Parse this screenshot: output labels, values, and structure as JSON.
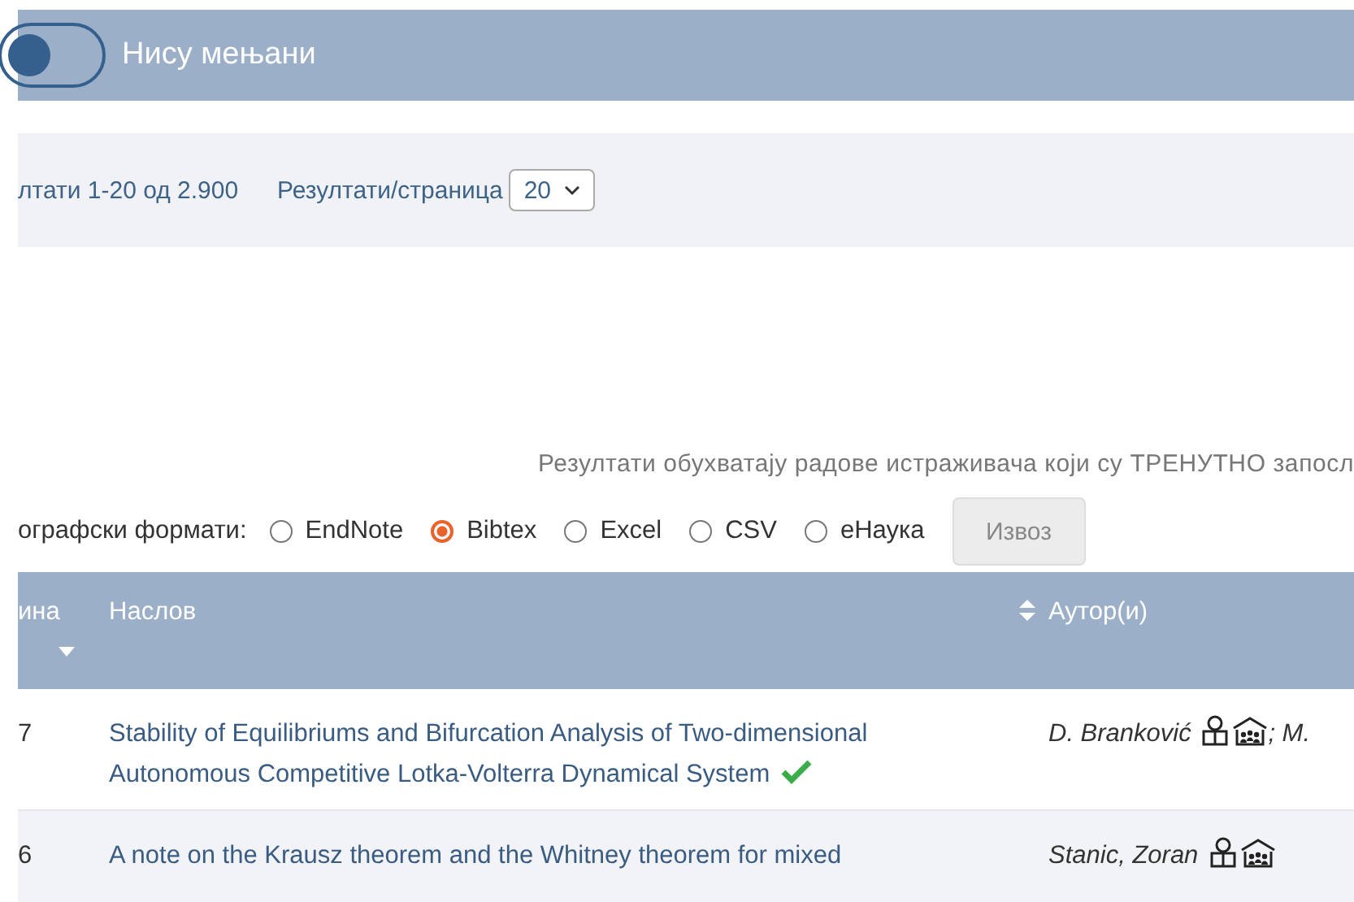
{
  "filter_bar": {
    "toggle": {
      "label": "Нису мењани",
      "on": false
    }
  },
  "results_bar": {
    "range": "лтати 1-20 од 2.900",
    "per_page_label": "Резултати/страница",
    "per_page": "20"
  },
  "note": "Резултати обухватају радове истраживача који су ТРЕНУТНО запосл",
  "export": {
    "label": "ографски формати:",
    "formats": [
      {
        "label": "EndNote",
        "selected": false
      },
      {
        "label": "Bibtex",
        "selected": true
      },
      {
        "label": "Excel",
        "selected": false
      },
      {
        "label": "CSV",
        "selected": false
      },
      {
        "label": "еНаука",
        "selected": false
      }
    ],
    "button": {
      "label": "Извоз",
      "disabled": true
    }
  },
  "table": {
    "columns": [
      {
        "label": "ина",
        "kind": "sorted"
      },
      {
        "label": "Наслов",
        "kind": "sortable"
      },
      {
        "label": "Аутор(и)",
        "kind": "plain"
      }
    ],
    "rows": [
      {
        "year": "7",
        "title": "Stability of Equilibriums and Bifurcation Analysis of Two-dimensional Autonomous Competitive Lotka-Volterra Dynamical System",
        "verified": true,
        "authors": [
          {
            "name": "D. Branković",
            "profile": true
          },
          {
            "name": "; M.",
            "profile": false
          }
        ]
      },
      {
        "year": "6",
        "title": "A note on the Krausz theorem and the Whitney theorem for mixed",
        "verified": false,
        "authors": [
          {
            "name": "Stanic, Zoran",
            "profile": true
          }
        ]
      }
    ]
  }
}
